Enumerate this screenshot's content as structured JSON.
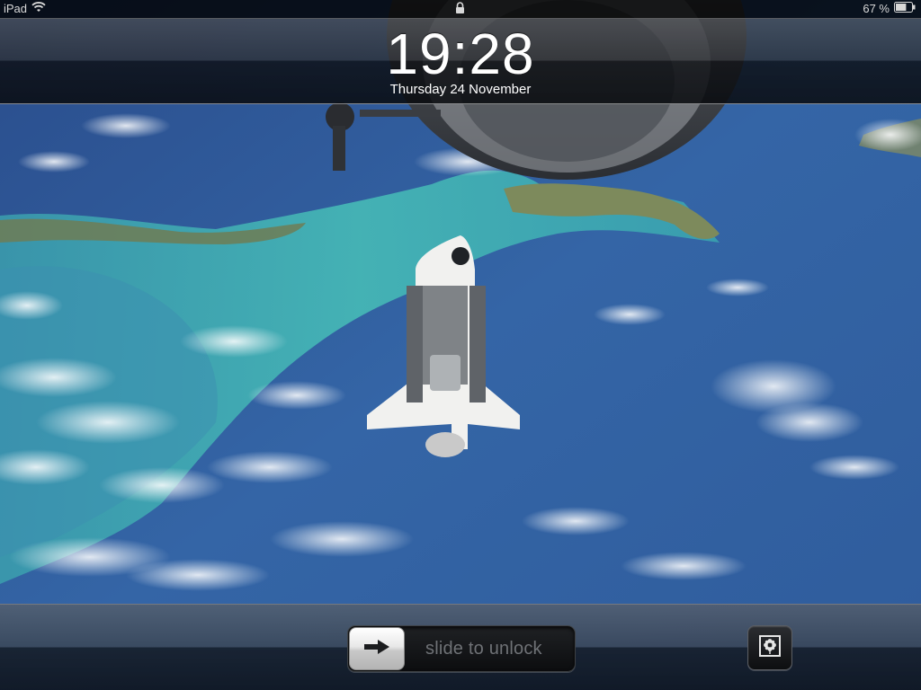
{
  "status_bar": {
    "device_name": "iPad",
    "battery_percent": "67 %",
    "battery_level": 0.67,
    "wifi_icon": "wifi-icon",
    "lock_icon": "lock-icon",
    "battery_icon": "battery-icon"
  },
  "lock_screen": {
    "time": "19:28",
    "date": "Thursday 24 November",
    "slider_label": "slide to unlock",
    "slider_icon": "right-arrow-icon",
    "picture_frame_icon": "picture-frame-flower-icon"
  },
  "wallpaper": {
    "description_icon": "space-shuttle-earth-wallpaper",
    "colors": {
      "ocean_deep": "#2b4f8e",
      "ocean_mid": "#3766a8",
      "shallow_water": "#3fb3b0",
      "land": "#7c8a5e",
      "clouds": "#f2f4f7"
    }
  }
}
